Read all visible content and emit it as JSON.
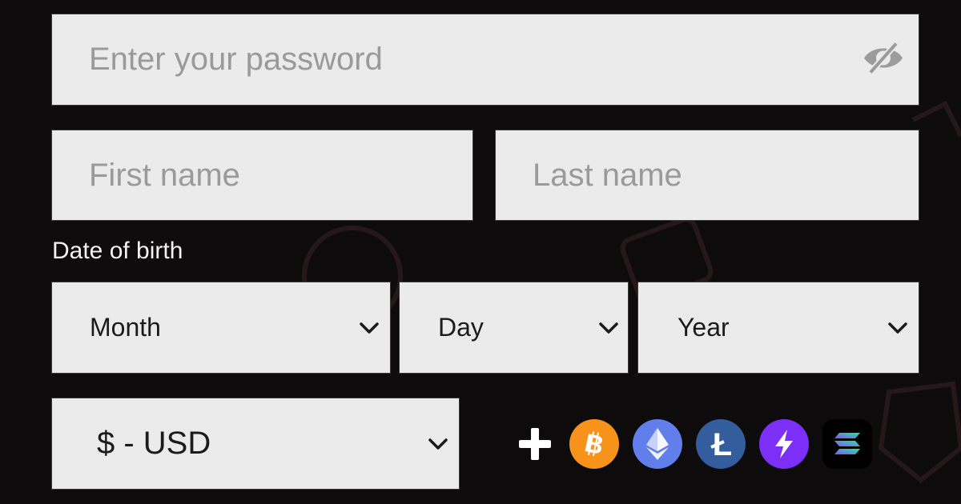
{
  "form": {
    "password": {
      "placeholder": "Enter your password",
      "visibility_icon": "eye-slash-icon"
    },
    "first_name": {
      "placeholder": "First name"
    },
    "last_name": {
      "placeholder": "Last name"
    },
    "dob": {
      "label": "Date of birth",
      "month": "Month",
      "day": "Day",
      "year": "Year"
    },
    "currency": {
      "value": "$ - USD"
    }
  },
  "payment_icons": [
    "plus-icon",
    "bitcoin-icon",
    "ethereum-icon",
    "litecoin-icon",
    "lightning-icon",
    "solana-icon"
  ],
  "colors": {
    "background": "#0d0b0c",
    "field": "#ebebeb",
    "bitcoin": "#f7931a",
    "ethereum": "#627eea",
    "litecoin": "#345d9d",
    "lightning": "#7b2ff7",
    "solana": "#14f195"
  }
}
